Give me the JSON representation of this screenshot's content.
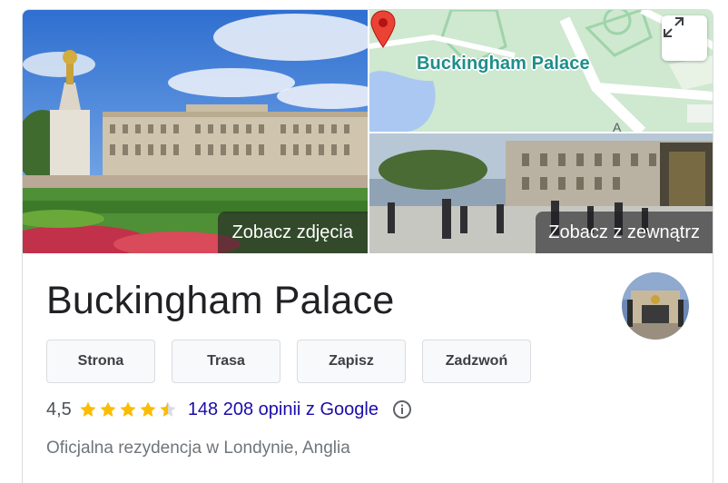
{
  "images": {
    "photos_label": "Zobacz zdjęcia",
    "map_place_name": "Buckingham Palace",
    "map_icon": "expand-icon",
    "street_label": "Zobacz z zewnątrz"
  },
  "place": {
    "name": "Buckingham Palace",
    "description": "Oficjalna rezydencja w Londynie, Anglia"
  },
  "actions": [
    {
      "label": "Strona"
    },
    {
      "label": "Trasa"
    },
    {
      "label": "Zapisz"
    },
    {
      "label": "Zadzwoń"
    }
  ],
  "rating": {
    "value": "4,5",
    "stars": 4.5,
    "reviews_text": "148 208 opinii z Google",
    "info_icon": "info-icon"
  },
  "colors": {
    "star": "#fbbc04",
    "link": "#1a0dab",
    "map_label": "#1e8e8a",
    "pin": "#ea4335"
  }
}
